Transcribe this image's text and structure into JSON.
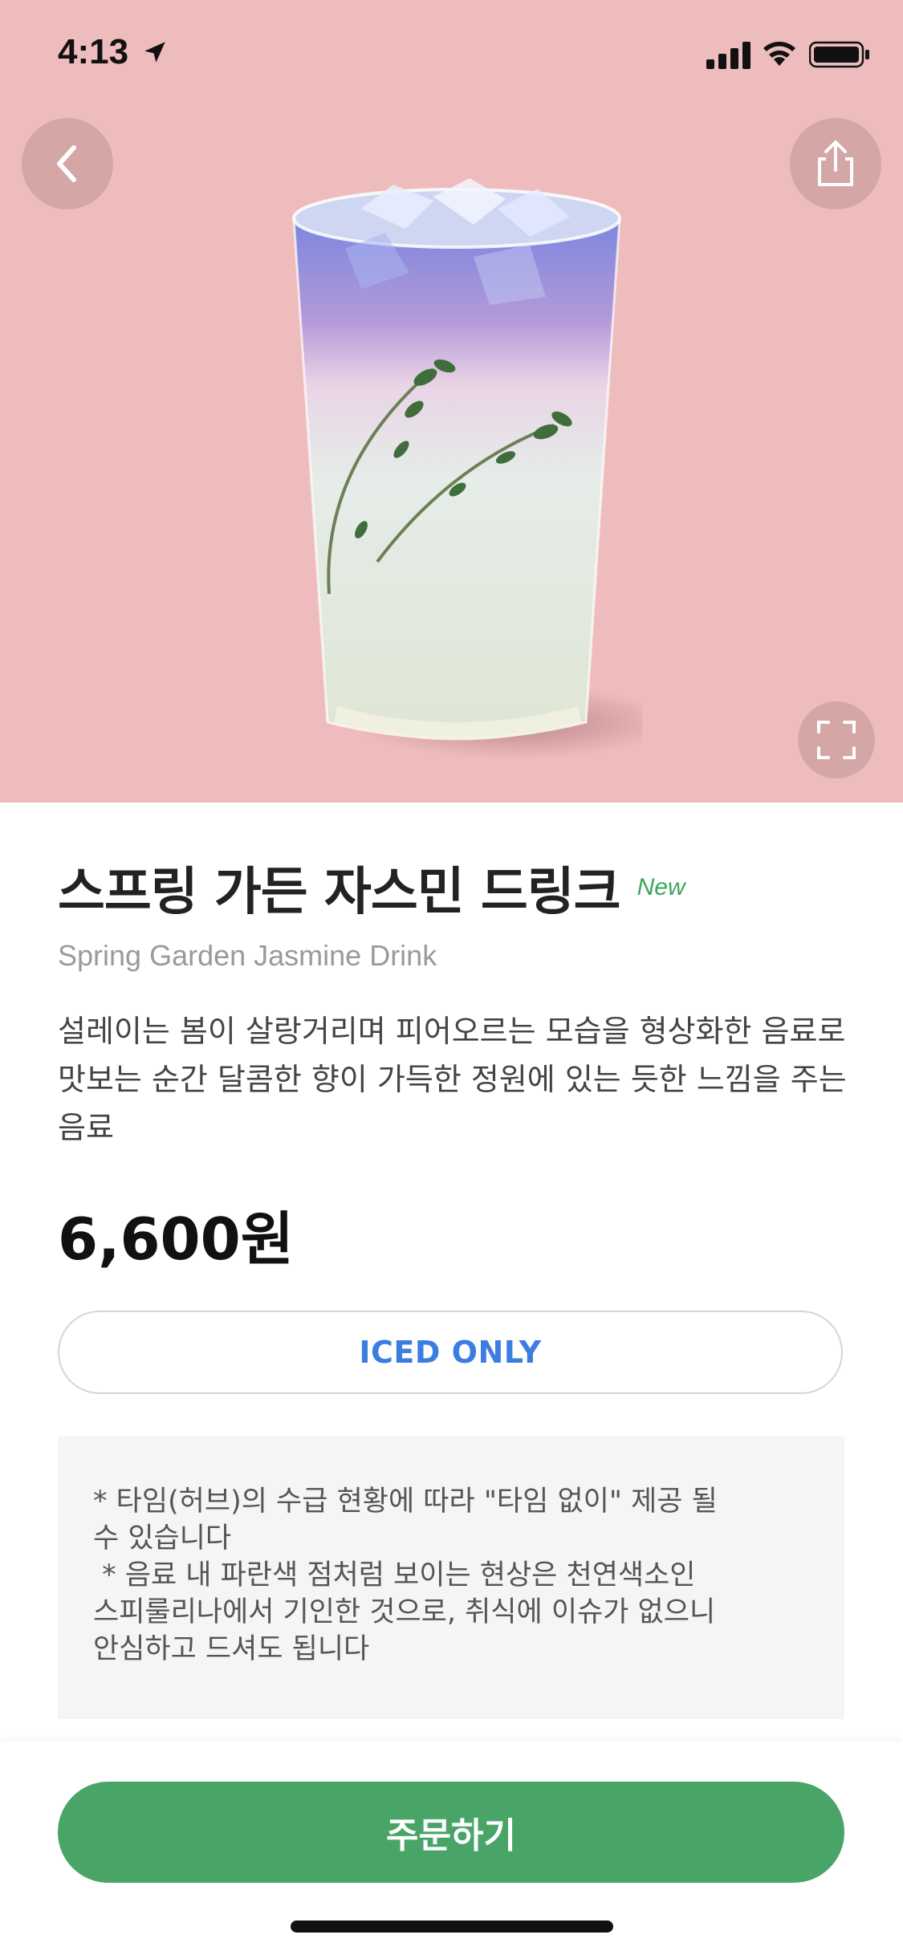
{
  "status_bar": {
    "time": "4:13",
    "icons": [
      "location-arrow-icon",
      "signal-icon",
      "wifi-icon",
      "battery-icon"
    ]
  },
  "hero": {
    "background_color": "#eebcbc",
    "image": "iced-drink-glass"
  },
  "product": {
    "title": "스프링 가든 자스민 드링크",
    "badge": "New",
    "subtitle": "Spring Garden Jasmine Drink",
    "description": "설레이는 봄이 살랑거리며 피어오르는 모습을 형상화한 음료로 맛보는 순간 달콤한 향이 가득한 정원에 있는 듯한 느낌을 주는 음료",
    "price": "6,600원",
    "temperature_option": "ICED ONLY"
  },
  "notice": {
    "lines": [
      "* 타임(허브)의 수급 현황에 따라 \"타임 없이\" 제공 될",
      "수 있습니다",
      " * 음료 내 파란색 점처럼 보이는 현상은 천연색소인",
      "스피룰리나에서 기인한 것으로, 취식에 이슈가 없으니",
      "안심하고 드셔도 됩니다"
    ]
  },
  "actions": {
    "order_label": "주문하기"
  },
  "colors": {
    "accent_green": "#49a468",
    "new_badge": "#3ba55d",
    "iced_text": "#3b7de0"
  }
}
